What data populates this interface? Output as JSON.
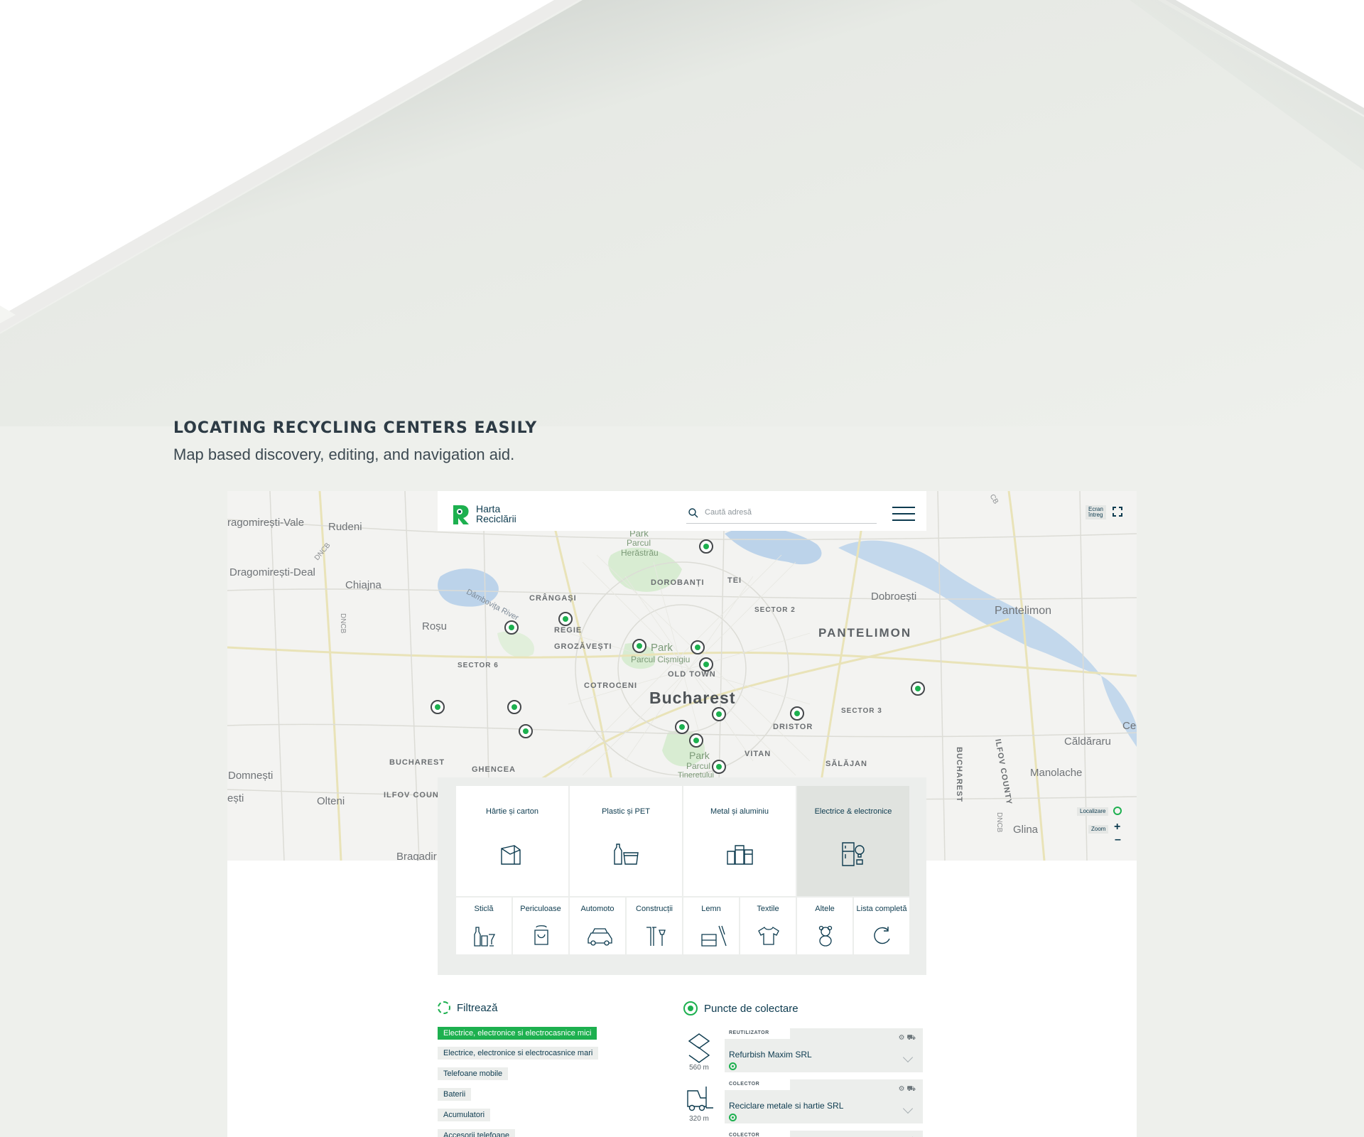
{
  "section": {
    "title": "LOCATING RECYCLING CENTERS EASILY",
    "subtitle": "Map based discovery, editing, and navigation aid."
  },
  "app": {
    "logo_line1": "Harta",
    "logo_line2": "Reciclării",
    "search_placeholder": "Caută adresă",
    "fullscreen_line1": "Ecran",
    "fullscreen_line2": "întreg",
    "locate_label": "Localizare",
    "zoom_label": "Zoom",
    "zoom_in": "+",
    "zoom_out": "–"
  },
  "map_places": [
    "ragomirești-Vale",
    "Rudeni",
    "Dragomirești-Deal",
    "Chiajna",
    "Roșu",
    "Domnești",
    "ești",
    "Olteni",
    "Bragadir",
    "Pantelimon",
    "Dobroești",
    "Căldăraru",
    "Manolache",
    "Glina",
    "Ce"
  ],
  "districts": [
    "CRÂNGAȘI",
    "REGIE",
    "GROZĂVEȘTI",
    "SECTOR 6",
    "COTROCENI",
    "BUCHAREST",
    "ILFOV COUN",
    "GHENCEA",
    "DOROBANȚI",
    "TEI",
    "SECTOR 2",
    "OLD TOWN",
    "DRISTOR",
    "SECTOR 3",
    "VITAN",
    "SĂLĂJAN",
    "PANTELIMON"
  ],
  "map_city": "Bucharest",
  "map_parks": [
    "Park",
    "Parcul",
    "Herăstrău",
    "Park",
    "Parcul Cișmigiu",
    "Park",
    "Parcul",
    "Tineretului"
  ],
  "map_river": "Dâmbovița River",
  "map_roads": [
    "DNCB",
    "DNCB",
    "DNCB",
    "CB",
    "BUCHAREST",
    "ILFOV COUNTY"
  ],
  "categories_big": [
    {
      "label": "Hârtie și carton",
      "icon": "paper-box-icon",
      "active": false
    },
    {
      "label": "Plastic și PET",
      "icon": "bottle-icon",
      "active": false
    },
    {
      "label": "Metal și aluminiu",
      "icon": "can-icon",
      "active": false
    },
    {
      "label": "Electrice & electronice",
      "icon": "fridge-icon",
      "active": true
    }
  ],
  "categories_small": [
    {
      "label": "Sticlă",
      "icon": "glass-icon"
    },
    {
      "label": "Periculoase",
      "icon": "paint-bucket-icon"
    },
    {
      "label": "Automoto",
      "icon": "car-icon"
    },
    {
      "label": "Construcții",
      "icon": "tools-icon"
    },
    {
      "label": "Lemn",
      "icon": "wood-icon"
    },
    {
      "label": "Textile",
      "icon": "tshirt-icon"
    },
    {
      "label": "Altele",
      "icon": "teddy-bear-icon"
    },
    {
      "label": "Lista completă",
      "icon": "refresh-icon"
    }
  ],
  "filters": {
    "title": "Filtrează",
    "chips": [
      {
        "label": "Electrice, electronice si electrocasnice mici",
        "active": true
      },
      {
        "label": "Electrice, electronice si electrocasnice mari",
        "active": false
      },
      {
        "label": "Telefoane mobile",
        "active": false
      },
      {
        "label": "Baterii",
        "active": false
      },
      {
        "label": "Acumulatori",
        "active": false
      },
      {
        "label": "Accesorii telefoane",
        "active": false
      }
    ]
  },
  "points": {
    "title": "Puncte de colectare",
    "items": [
      {
        "tag": "REUTILIZATOR",
        "name": "Refurbish Maxim SRL",
        "distance": "560 m",
        "icon": "handshake-icon"
      },
      {
        "tag": "COLECTOR",
        "name": "Reciclare metale si hartie SRL",
        "distance": "320 m",
        "icon": "forklift-icon"
      },
      {
        "tag": "COLECTOR",
        "name": "",
        "distance": "",
        "icon": "forklift-icon"
      }
    ]
  },
  "colors": {
    "accent_green": "#1db04f",
    "navy": "#0d3b4f",
    "page_bg": "#eef0ec"
  }
}
